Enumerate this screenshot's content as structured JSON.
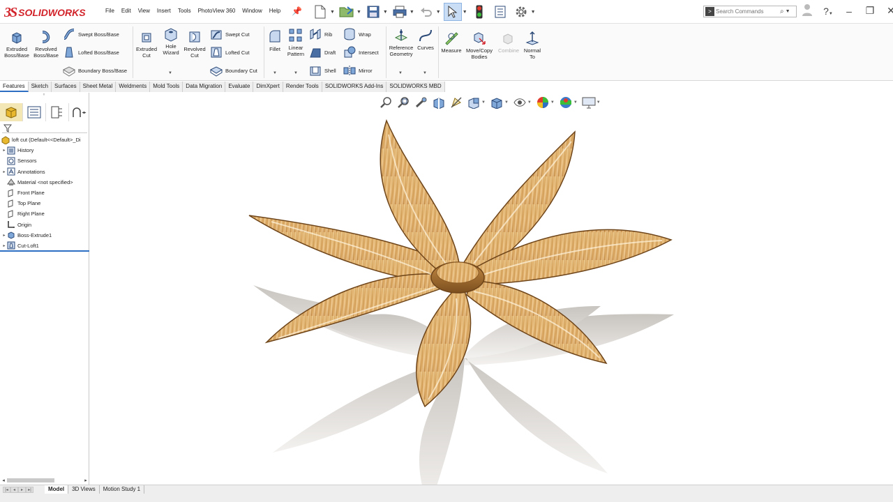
{
  "app": {
    "logo_ds": "3S",
    "logo_text": "SOLIDWORKS"
  },
  "menu": [
    "File",
    "Edit",
    "View",
    "Insert",
    "Tools",
    "PhotoView 360",
    "Window",
    "Help"
  ],
  "search": {
    "placeholder": "Search Commands"
  },
  "ribbon": {
    "extruded_boss": "Extruded Boss/Base",
    "revolved_boss": "Revolved Boss/Base",
    "swept_boss": "Swept Boss/Base",
    "lofted_boss": "Lofted Boss/Base",
    "boundary_boss": "Boundary Boss/Base",
    "extruded_cut": "Extruded Cut",
    "hole_wizard": "Hole Wizard",
    "revolved_cut": "Revolved Cut",
    "swept_cut": "Swept Cut",
    "lofted_cut": "Lofted Cut",
    "boundary_cut": "Boundary Cut",
    "fillet": "Fillet",
    "linear_pattern": "Linear Pattern",
    "rib": "Rib",
    "wrap": "Wrap",
    "draft": "Draft",
    "intersect": "Intersect",
    "shell": "Shell",
    "mirror": "Mirror",
    "reference_geometry": "Reference Geometry",
    "curves": "Curves",
    "measure": "Measure",
    "move_copy": "Move/Copy Bodies",
    "combine": "Combine",
    "normal_to": "Normal To"
  },
  "tabs": [
    {
      "label": "Features",
      "active": true
    },
    {
      "label": "Sketch",
      "active": false
    },
    {
      "label": "Surfaces",
      "active": false
    },
    {
      "label": "Sheet Metal",
      "active": false
    },
    {
      "label": "Weldments",
      "active": false
    },
    {
      "label": "Mold Tools",
      "active": false
    },
    {
      "label": "Data Migration",
      "active": false
    },
    {
      "label": "Evaluate",
      "active": false
    },
    {
      "label": "DimXpert",
      "active": false
    },
    {
      "label": "Render Tools",
      "active": false
    },
    {
      "label": "SOLIDWORKS Add-Ins",
      "active": false
    },
    {
      "label": "SOLIDWORKS MBD",
      "active": false
    }
  ],
  "tree": {
    "root": "loft cut  (Default<<Default>_Di",
    "items": [
      {
        "label": "History",
        "expandable": true,
        "icon": "history-icon"
      },
      {
        "label": "Sensors",
        "expandable": false,
        "icon": "sensors-icon"
      },
      {
        "label": "Annotations",
        "expandable": true,
        "icon": "annotations-icon"
      },
      {
        "label": "Material <not specified>",
        "expandable": false,
        "icon": "material-icon"
      },
      {
        "label": "Front Plane",
        "expandable": false,
        "icon": "plane-icon"
      },
      {
        "label": "Top Plane",
        "expandable": false,
        "icon": "plane-icon"
      },
      {
        "label": "Right Plane",
        "expandable": false,
        "icon": "plane-icon"
      },
      {
        "label": "Origin",
        "expandable": false,
        "icon": "origin-icon"
      },
      {
        "label": "Boss-Extrude1",
        "expandable": true,
        "icon": "extrude-feature-icon"
      },
      {
        "label": "Cut-Loft1",
        "expandable": true,
        "icon": "loft-cut-feature-icon"
      }
    ]
  },
  "bottom_tabs": [
    {
      "label": "Model",
      "active": true
    },
    {
      "label": "3D Views",
      "active": false
    },
    {
      "label": "Motion Study 1",
      "active": false
    }
  ],
  "colors": {
    "wood_light": "#e8c080",
    "wood_mid": "#c8924a",
    "wood_dark": "#8a5a24",
    "accent": "#2d6fc3",
    "logo_red": "#d2232a"
  }
}
